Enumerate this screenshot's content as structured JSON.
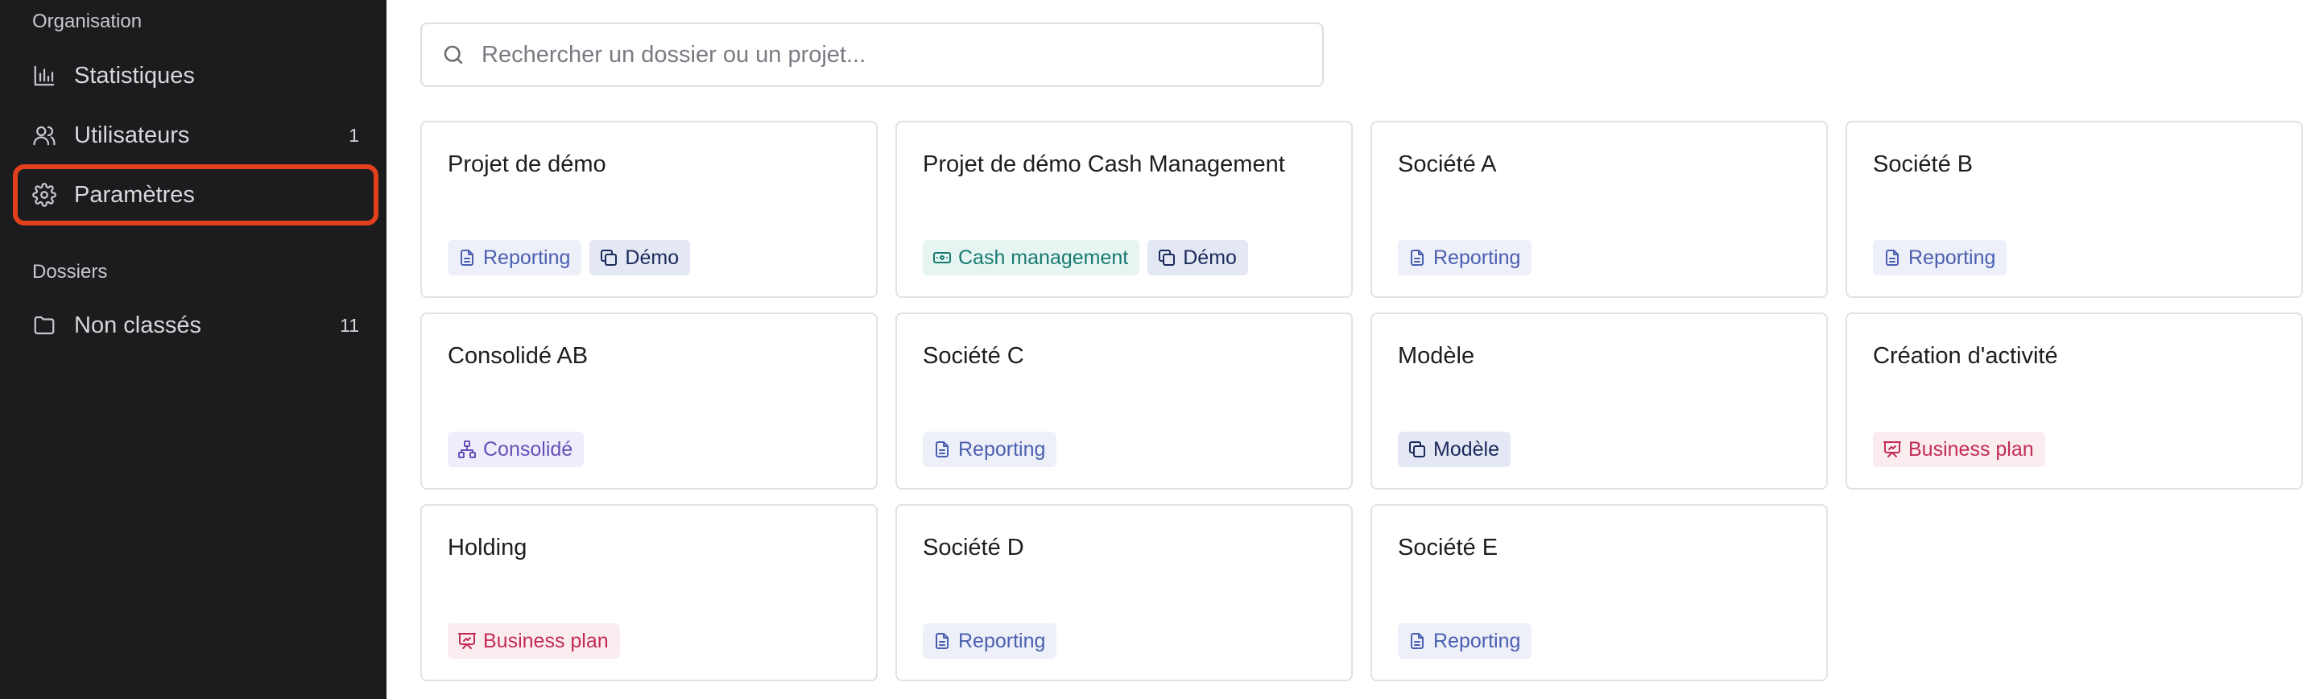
{
  "sidebar": {
    "organisation_title": "Organisation",
    "items": [
      {
        "label": "Statistiques",
        "count": ""
      },
      {
        "label": "Utilisateurs",
        "count": "1"
      },
      {
        "label": "Paramètres",
        "count": ""
      }
    ],
    "dossiers_title": "Dossiers",
    "folders": [
      {
        "label": "Non classés",
        "count": "11"
      }
    ]
  },
  "search": {
    "placeholder": "Rechercher un dossier ou un projet..."
  },
  "colors": {
    "sidebar_bg": "#1c1c1e",
    "highlight": "#e2401d"
  },
  "projects": [
    {
      "title": "Projet de démo",
      "tags": [
        "Reporting",
        "Démo"
      ]
    },
    {
      "title": "Projet de démo Cash Management",
      "tags": [
        "Cash management",
        "Démo"
      ]
    },
    {
      "title": "Société A",
      "tags": [
        "Reporting"
      ]
    },
    {
      "title": "Société B",
      "tags": [
        "Reporting"
      ]
    },
    {
      "title": "Consolidé AB",
      "tags": [
        "Consolidé"
      ]
    },
    {
      "title": "Société C",
      "tags": [
        "Reporting"
      ]
    },
    {
      "title": "Modèle",
      "tags": [
        "Modèle"
      ]
    },
    {
      "title": "Création d'activité",
      "tags": [
        "Business plan"
      ]
    },
    {
      "title": "Holding",
      "tags": [
        "Business plan"
      ]
    },
    {
      "title": "Société D",
      "tags": [
        "Reporting"
      ]
    },
    {
      "title": "Société E",
      "tags": [
        "Reporting"
      ]
    }
  ]
}
